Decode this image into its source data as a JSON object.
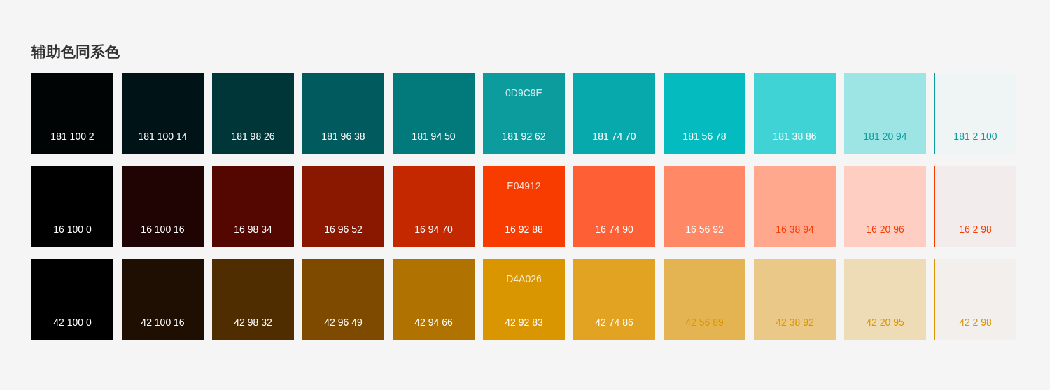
{
  "title": "辅助色同系色",
  "rows": [
    {
      "swatches": [
        {
          "kind": "filled",
          "color": "#000405",
          "label": "181 100 2"
        },
        {
          "kind": "filled",
          "color": "#001316",
          "label": "181 100 14"
        },
        {
          "kind": "filled",
          "color": "#003638",
          "label": "181 98 26"
        },
        {
          "kind": "filled",
          "color": "#005A5E",
          "label": "181 96 38"
        },
        {
          "kind": "filled",
          "color": "#027A7C",
          "label": "181 94 50"
        },
        {
          "kind": "filled",
          "color": "#0D9C9E",
          "label": "181 92 62",
          "hex": "0D9C9E"
        },
        {
          "kind": "filled",
          "color": "#07A9AD",
          "label": "181 74 70"
        },
        {
          "kind": "filled",
          "color": "#04BCBF",
          "label": "181 56 78"
        },
        {
          "kind": "filled",
          "color": "#40D3D6",
          "label": "181 38 86"
        },
        {
          "kind": "filled",
          "color": "#9DE5E5",
          "label": "181 20 94"
        },
        {
          "kind": "outlined",
          "color": "#EFF5F5",
          "label": "181 2 100"
        }
      ]
    },
    {
      "swatches": [
        {
          "kind": "filled",
          "color": "#000000",
          "label": "16 100 0"
        },
        {
          "kind": "filled",
          "color": "#200404",
          "label": "16 100 16"
        },
        {
          "kind": "filled",
          "color": "#530700",
          "label": "16 98 34"
        },
        {
          "kind": "filled",
          "color": "#8A1800",
          "label": "16 96 52"
        },
        {
          "kind": "filled",
          "color": "#C42800",
          "label": "16 94 70"
        },
        {
          "kind": "filled",
          "color": "#F83C00",
          "label": "16 92 88",
          "hex": "E04912"
        },
        {
          "kind": "filled",
          "color": "#FF5F35",
          "label": "16 74 90"
        },
        {
          "kind": "filled",
          "color": "#FF8866",
          "label": "16 56 92"
        },
        {
          "kind": "filled",
          "color": "#FFA88E",
          "label": "16 38 94"
        },
        {
          "kind": "filled",
          "color": "#FFCEC3",
          "label": "16 20 96"
        },
        {
          "kind": "outlined",
          "color": "#F2ECEC",
          "label": "16 2 98"
        }
      ]
    },
    {
      "swatches": [
        {
          "kind": "filled",
          "color": "#000000",
          "label": "42 100 0"
        },
        {
          "kind": "filled",
          "color": "#1E0F02",
          "label": "42 100 16"
        },
        {
          "kind": "filled",
          "color": "#4F2D00",
          "label": "42 98 32"
        },
        {
          "kind": "filled",
          "color": "#7D4A00",
          "label": "42 96 49"
        },
        {
          "kind": "filled",
          "color": "#B07200",
          "label": "42 94 66"
        },
        {
          "kind": "filled",
          "color": "#DA9600",
          "label": "42 92 83",
          "hex": "D4A026"
        },
        {
          "kind": "filled",
          "color": "#E1A321",
          "label": "42 74 86"
        },
        {
          "kind": "filled",
          "color": "#E5B452",
          "label": "42 56 89"
        },
        {
          "kind": "filled",
          "color": "#EAC887",
          "label": "42 38 92"
        },
        {
          "kind": "filled",
          "color": "#EEDCB6",
          "label": "42 20 95"
        },
        {
          "kind": "outlined",
          "color": "#F2EFEC",
          "label": "42 2 98"
        }
      ]
    }
  ]
}
